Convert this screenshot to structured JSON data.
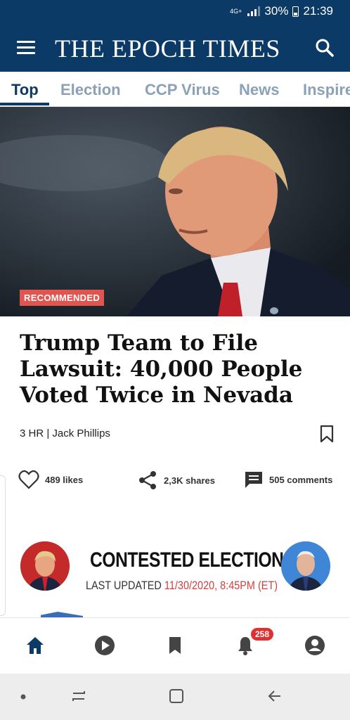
{
  "status": {
    "network": "4G+",
    "battery": "30%",
    "time": "21:39"
  },
  "app": {
    "title": "THE EPOCH TIMES"
  },
  "tabs": [
    {
      "label": "Top",
      "active": true
    },
    {
      "label": "Election",
      "active": false
    },
    {
      "label": "CCP Virus",
      "active": false
    },
    {
      "label": "News",
      "active": false
    },
    {
      "label": "Inspire",
      "active": false
    }
  ],
  "article": {
    "badge": "RECOMMENDED",
    "headline": "Trump Team to File Lawsuit: 40,000 People Voted Twice in Nevada",
    "byline": "3 HR | Jack Phillips",
    "likes": "489 likes",
    "shares": "2,3K shares",
    "comments": "505 comments"
  },
  "contested": {
    "title": "CONTESTED ELECTION",
    "updated_label": "LAST UPDATED ",
    "updated_date": "11/30/2020, 8:45PM (ET)"
  },
  "bottom_nav": {
    "notification_count": "258"
  },
  "colors": {
    "brand": "#0c3a66",
    "accent": "#e05550",
    "tab_inactive": "#8aa1b8"
  }
}
